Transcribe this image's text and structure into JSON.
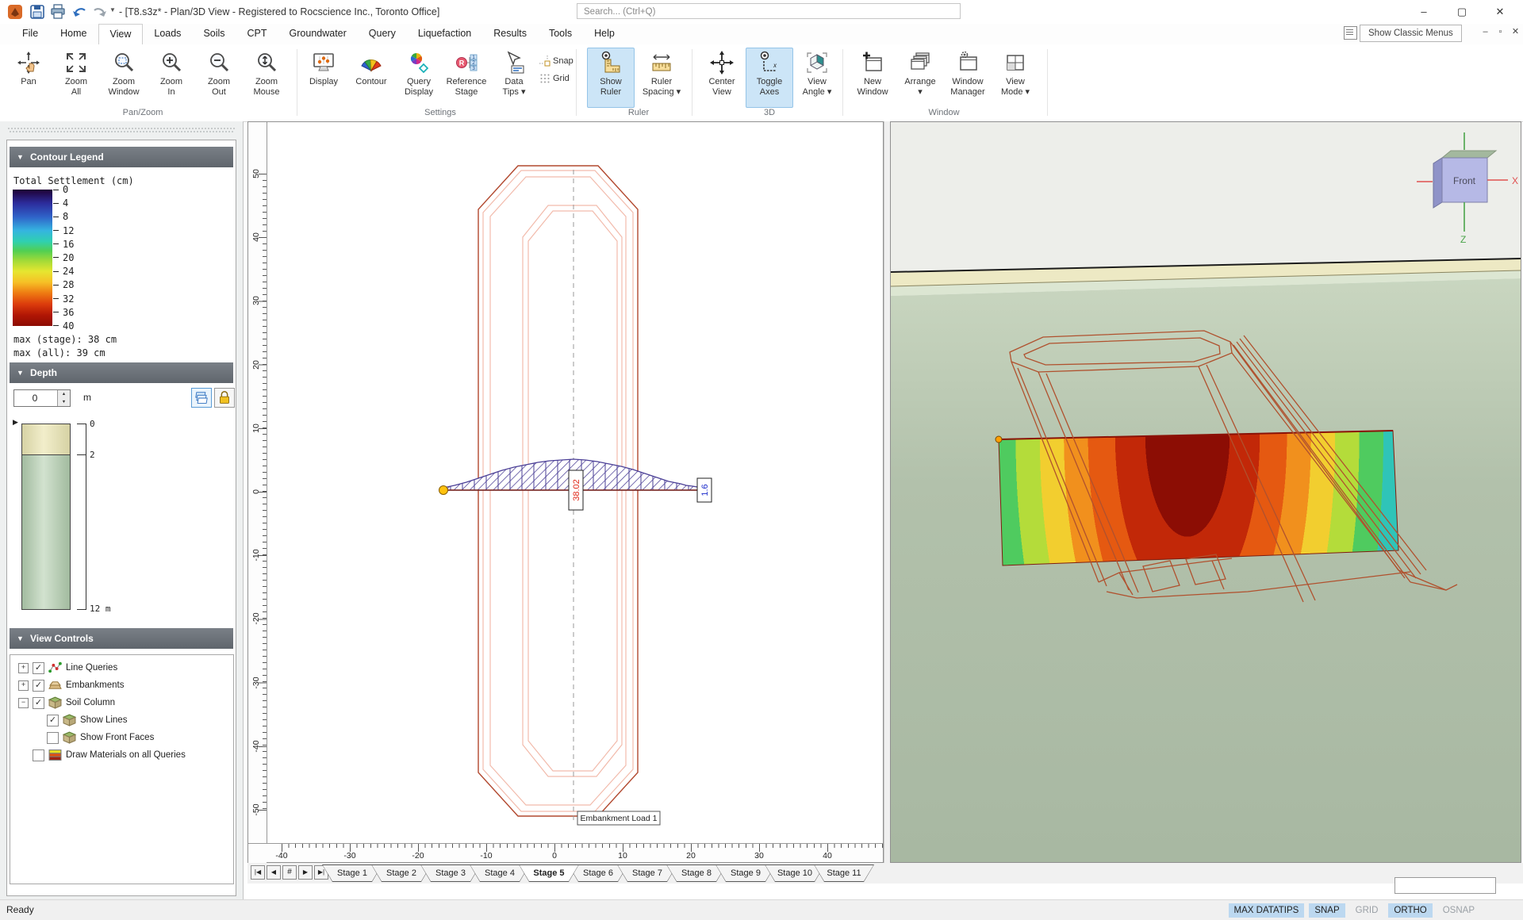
{
  "titlebar": {
    "title": "- [T8.s3z* - Plan/3D View - Registered to Rocscience Inc., Toronto Office]",
    "search_placeholder": "Search... (Ctrl+Q)",
    "window_buttons": {
      "minimize": "–",
      "maximize": "▢",
      "close": "✕"
    }
  },
  "menu": {
    "items": [
      {
        "label": "File"
      },
      {
        "label": "Home"
      },
      {
        "label": "View",
        "active": true
      },
      {
        "label": "Loads"
      },
      {
        "label": "Soils"
      },
      {
        "label": "CPT"
      },
      {
        "label": "Groundwater"
      },
      {
        "label": "Query"
      },
      {
        "label": "Liquefaction"
      },
      {
        "label": "Results"
      },
      {
        "label": "Tools"
      },
      {
        "label": "Help"
      }
    ],
    "show_classic_menus": "Show Classic Menus",
    "child_controls": {
      "minimize": "–",
      "restore": "▫",
      "close": "✕"
    }
  },
  "ribbon": {
    "groups": [
      "Pan/Zoom",
      "Settings",
      "Ruler",
      "3D",
      "Window"
    ],
    "buttons": {
      "pan": "Pan",
      "zoom_all": "Zoom\nAll",
      "zoom_window": "Zoom\nWindow",
      "zoom_in": "Zoom\nIn",
      "zoom_out": "Zoom\nOut",
      "zoom_mouse": "Zoom\nMouse",
      "display": "Display",
      "contour": "Contour",
      "query_display": "Query\nDisplay",
      "reference_stage": "Reference\nStage",
      "data_tips": "Data\nTips ▾",
      "snap": "Snap",
      "grid": "Grid",
      "show_ruler": "Show\nRuler",
      "ruler_spacing": "Ruler\nSpacing ▾",
      "center_view": "Center\nView",
      "toggle_axes": "Toggle\nAxes",
      "view_angle": "View\nAngle ▾",
      "new_window": "New\nWindow",
      "arrange": "Arrange\n▾",
      "window_manager": "Window\nManager",
      "view_mode": "View\nMode ▾"
    }
  },
  "legend": {
    "header": "Contour Legend",
    "title": "Total Settlement (cm)",
    "ticks": [
      "0",
      "4",
      "8",
      "12",
      "16",
      "20",
      "24",
      "28",
      "32",
      "36",
      "40"
    ],
    "max_stage": "max (stage): 38 cm",
    "max_all": "max (all):  39 cm"
  },
  "depth": {
    "header": "Depth",
    "value": "0",
    "unit": "m",
    "scale": {
      "top": "0",
      "mid": "2",
      "bottom": "12 m"
    }
  },
  "view_controls": {
    "header": "View Controls",
    "items": [
      {
        "expand": "+",
        "check": "✓",
        "label": "Line Queries"
      },
      {
        "expand": "+",
        "check": "✓",
        "label": "Embankments"
      },
      {
        "expand": "−",
        "check": "✓",
        "label": "Soil Column"
      },
      {
        "check": "✓",
        "label": "Show Lines"
      },
      {
        "check": "",
        "label": "Show Front Faces"
      },
      {
        "check": "",
        "label": "Draw Materials on all Queries"
      }
    ]
  },
  "plan_view": {
    "v_ticks": [
      "50",
      "40",
      "30",
      "20",
      "10",
      "0",
      "-10",
      "-20",
      "-30",
      "-40",
      "-50"
    ],
    "h_ticks": [
      "-40",
      "-30",
      "-20",
      "-10",
      "0",
      "10",
      "20",
      "30",
      "40"
    ],
    "max_label": "38.02",
    "end_label": "1.6",
    "load_label": "Embankment Load 1"
  },
  "view3d": {
    "cube_label": "Front",
    "axis_x": "X",
    "axis_z": "Z"
  },
  "stage_tabs": {
    "nav": [
      "|◀",
      "◀",
      "#",
      "▶",
      "▶|"
    ],
    "tabs": [
      {
        "label": "Stage 1"
      },
      {
        "label": "Stage 2"
      },
      {
        "label": "Stage 3"
      },
      {
        "label": "Stage 4"
      },
      {
        "label": "Stage 5",
        "active": true
      },
      {
        "label": "Stage 6"
      },
      {
        "label": "Stage 7"
      },
      {
        "label": "Stage 8"
      },
      {
        "label": "Stage 9"
      },
      {
        "label": "Stage 10"
      },
      {
        "label": "Stage 11"
      }
    ]
  },
  "statusbar": {
    "ready": "Ready",
    "toggles": [
      {
        "label": "MAX DATATIPS",
        "state": "on"
      },
      {
        "label": "SNAP",
        "state": "on"
      },
      {
        "label": "GRID",
        "state": "off"
      },
      {
        "label": "ORTHO",
        "state": "on"
      },
      {
        "label": "OSNAP",
        "state": "off"
      }
    ]
  },
  "colors": {
    "ribbon_active_bg": "#cce5f7",
    "status_active_bg": "#bcd8f0",
    "panel_header": "#666c73",
    "embankment_outline": "#b2482e",
    "embankment_inner": "#f2bbac",
    "load_hatch": "#4a3e96",
    "query_line": "#7a2418",
    "query_point": "#ffc20e",
    "max_value_text": "#e02818",
    "end_value_text": "#2030cc",
    "ground_3d": "#b2c1ab",
    "contour_max": "#8c0d04",
    "contour_min": "#241a55"
  }
}
